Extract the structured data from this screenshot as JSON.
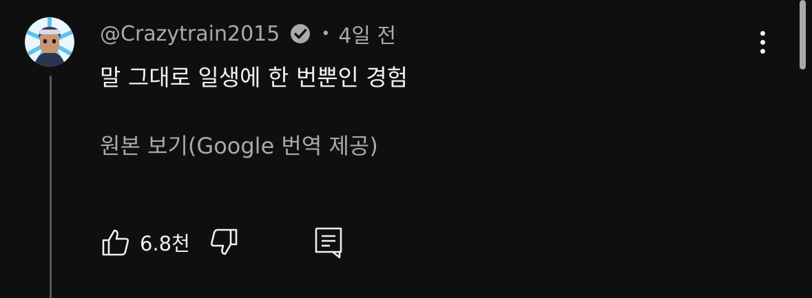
{
  "comment": {
    "author": "@Crazytrain2015",
    "verified": true,
    "separator": "•",
    "time_ago": "4일 전",
    "text": "말 그대로 일생에 한 번뿐인 경험",
    "see_original": "원본 보기(Google 번역 제공)",
    "like_count": "6.8천"
  },
  "icons": {
    "avatar": "avatar-cartoon",
    "verified": "verified-check-icon",
    "like": "thumbs-up-icon",
    "dislike": "thumbs-down-icon",
    "reply": "comment-reply-icon",
    "more": "more-vertical-icon"
  },
  "colors": {
    "background": "#0f0f0f",
    "primary_text": "#f1f1f1",
    "secondary_text": "#aaaaaa",
    "thread_line": "#5a5a5a",
    "avatar_ring": "#5ec2ea"
  }
}
